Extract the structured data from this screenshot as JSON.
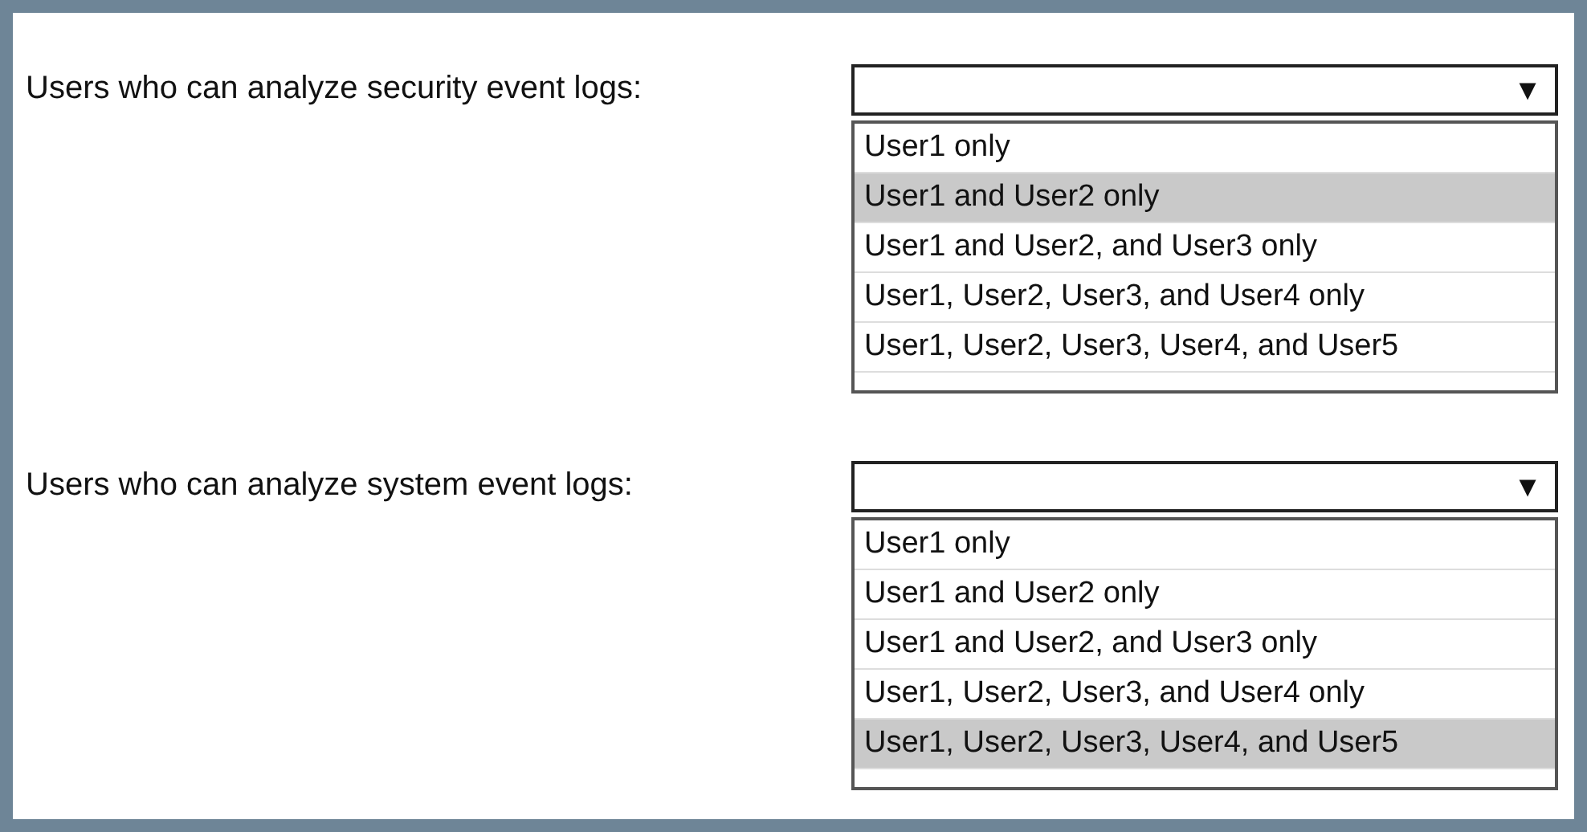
{
  "questions": [
    {
      "label": "Users who can analyze security event logs:",
      "arrow": "▼",
      "options": [
        {
          "text": "User1 only",
          "selected": false
        },
        {
          "text": "User1 and User2 only",
          "selected": true
        },
        {
          "text": "User1 and User2, and User3 only",
          "selected": false
        },
        {
          "text": "User1, User2, User3, and User4 only",
          "selected": false
        },
        {
          "text": "User1, User2, User3, User4, and User5",
          "selected": false
        }
      ]
    },
    {
      "label": "Users who can analyze system event logs:",
      "arrow": "▼",
      "options": [
        {
          "text": "User1 only",
          "selected": false
        },
        {
          "text": "User1 and User2 only",
          "selected": false
        },
        {
          "text": "User1 and User2, and User3 only",
          "selected": false
        },
        {
          "text": "User1, User2, User3, and User4 only",
          "selected": false
        },
        {
          "text": "User1, User2, User3, User4, and User5",
          "selected": true
        }
      ]
    }
  ]
}
